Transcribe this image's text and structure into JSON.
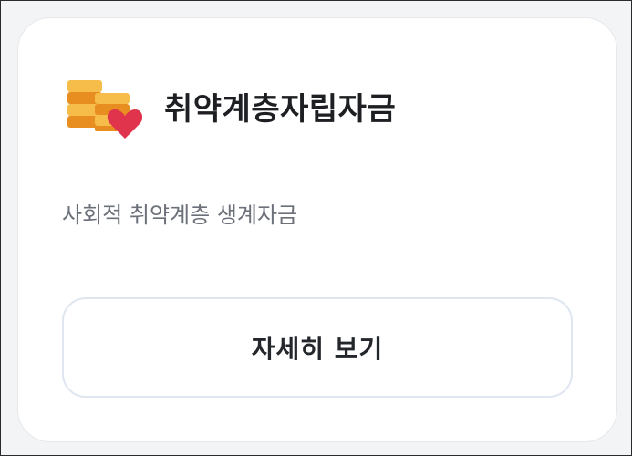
{
  "card": {
    "icon": "coin-stack-heart-icon",
    "title": "취약계층자립자금",
    "description": "사회적 취약계층 생계자금",
    "button_label": "자세히 보기"
  },
  "colors": {
    "coin_light": "#f6bd4b",
    "coin_dark": "#e88d1f",
    "heart": "#e0344d",
    "title": "#1d1f23",
    "description": "#6b7079",
    "button_border": "#dfe6ef"
  }
}
